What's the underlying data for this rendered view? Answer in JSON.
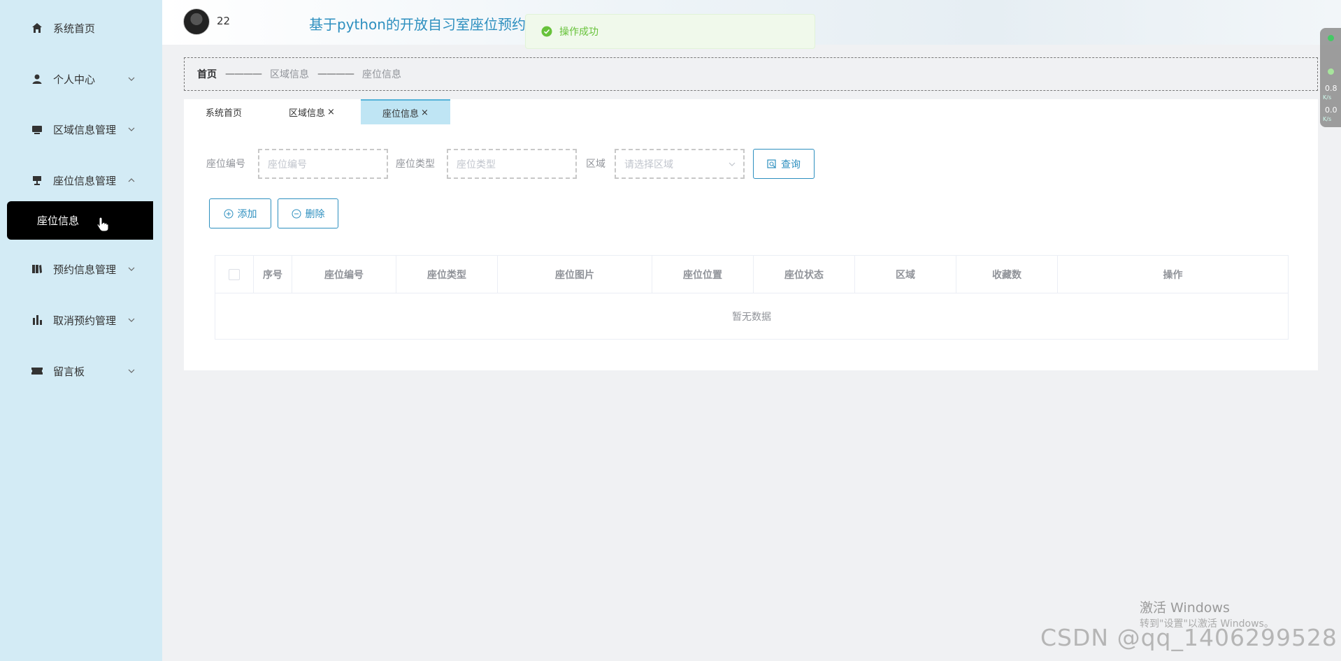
{
  "sidebar": {
    "items": [
      {
        "label": "系统首页",
        "icon": "home-icon",
        "has_arrow": false
      },
      {
        "label": "个人中心",
        "icon": "user-icon",
        "has_arrow": true
      },
      {
        "label": "区域信息管理",
        "icon": "monitor-icon",
        "has_arrow": true
      },
      {
        "label": "座位信息管理",
        "icon": "seat-icon",
        "has_arrow": true,
        "expanded": true
      },
      {
        "label": "预约信息管理",
        "icon": "book-icon",
        "has_arrow": true
      },
      {
        "label": "取消预约管理",
        "icon": "bar-chart-icon",
        "has_arrow": true
      },
      {
        "label": "留言板",
        "icon": "ticket-icon",
        "has_arrow": true
      }
    ],
    "active_sub": "座位信息"
  },
  "header": {
    "username": "22",
    "title": "基于python的开放自习室座位预约"
  },
  "toast": {
    "text": "操作成功",
    "color": "#67c23a"
  },
  "breadcrumb": {
    "home": "首页",
    "separator": "————",
    "items": [
      "区域信息",
      "座位信息"
    ]
  },
  "tabs": [
    {
      "label": "系统首页",
      "closable": false,
      "active": false
    },
    {
      "label": "区域信息",
      "closable": true,
      "active": false
    },
    {
      "label": "座位信息",
      "closable": true,
      "active": true
    }
  ],
  "search": {
    "seat_no_label": "座位编号",
    "seat_no_placeholder": "座位编号",
    "seat_type_label": "座位类型",
    "seat_type_placeholder": "座位类型",
    "area_label": "区域",
    "area_placeholder": "请选择区域",
    "query_button": "查询"
  },
  "actions": {
    "add": "添加",
    "delete": "删除"
  },
  "table": {
    "columns": [
      "序号",
      "座位编号",
      "座位类型",
      "座位图片",
      "座位位置",
      "座位状态",
      "区域",
      "收藏数",
      "操作"
    ],
    "empty_text": "暂无数据"
  },
  "net_widget": {
    "upload": "0.8",
    "upload_unit": "K/s",
    "download": "0.0",
    "download_unit": "K/s"
  },
  "windows": {
    "activate_title": "激活 Windows",
    "activate_sub": "转到\"设置\"以激活 Windows。"
  },
  "watermark": "CSDN @qq_1406299528",
  "colors": {
    "accent": "#2d8fbf",
    "sidebar_bg": "#d3ebf5",
    "active_tab": "#bfe5f4",
    "success": "#67c23a"
  }
}
